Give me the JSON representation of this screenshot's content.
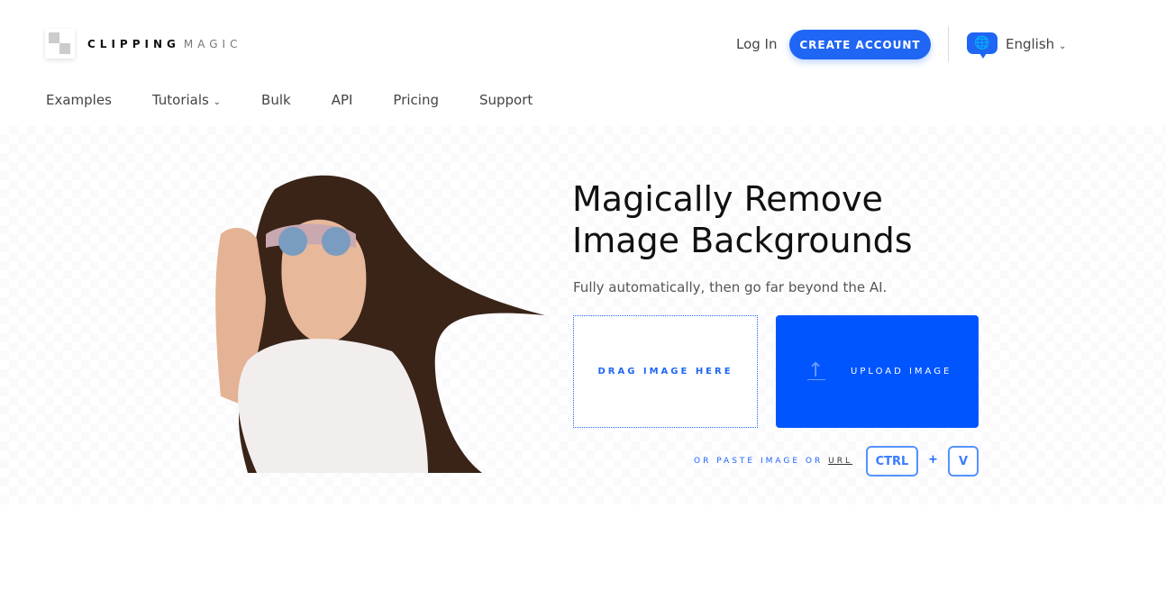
{
  "brand": {
    "name_bold": "CLIPPING",
    "name_light": "MAGIC"
  },
  "header": {
    "login": "Log In",
    "create_account": "CREATE ACCOUNT",
    "language": "English",
    "language_icon": "globe-icon"
  },
  "nav": {
    "items": [
      "Examples",
      "Tutorials",
      "Bulk",
      "API",
      "Pricing",
      "Support"
    ]
  },
  "hero": {
    "title_line1": "Magically Remove",
    "title_line2": "Image Backgrounds",
    "subtitle": "Fully automatically, then go far beyond the AI.",
    "drag_label": "DRAG IMAGE HERE",
    "upload_label": "UPLOAD IMAGE",
    "paste_text": "OR PASTE IMAGE OR",
    "url_link": "URL",
    "key_ctrl": "CTRL",
    "plus": "+",
    "key_v": "V"
  },
  "colors": {
    "accent": "#1f66f5",
    "upload_bg": "#0055ff"
  }
}
